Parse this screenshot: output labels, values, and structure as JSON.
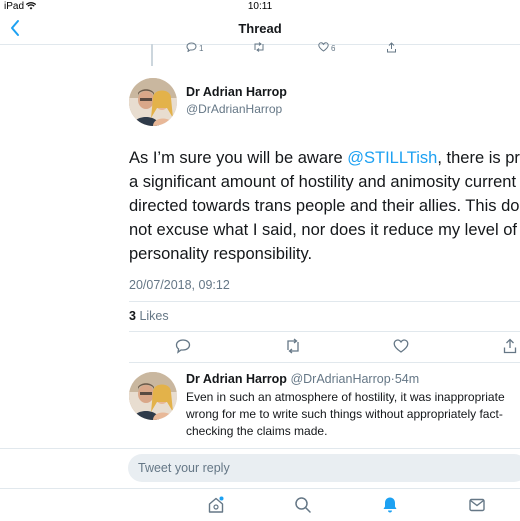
{
  "status_bar": {
    "device": "iPad",
    "time": "10:11"
  },
  "nav": {
    "title": "Thread"
  },
  "previous_tweet": {
    "actions": {
      "replies": "1",
      "retweets": "",
      "likes": "6"
    }
  },
  "tweet": {
    "author_name": "Dr Adrian Harrop",
    "author_handle": "@DrAdrianHarrop",
    "lines": [
      {
        "before": "As I’m sure you will be aware ",
        "mention": "@STILLTish",
        "after": ", there is pre"
      },
      {
        "text": "a significant amount of hostility and animosity current"
      },
      {
        "text": "directed towards trans people and their allies. This do"
      },
      {
        "text": "not excuse what I said, nor does it reduce my level of"
      },
      {
        "text": "personality responsibility."
      }
    ],
    "timestamp": "20/07/2018, 09:12",
    "likes_count": "3",
    "likes_label": "Likes"
  },
  "reply": {
    "author_name": "Dr Adrian Harrop",
    "author_handle": "@DrAdrianHarrop",
    "separator": "·",
    "time_ago": "54m",
    "lines": [
      "Even in such an atmosphere of hostility, it was inappropriate",
      "wrong for me to write such things without appropriately fact-",
      "checking the claims made."
    ]
  },
  "compose": {
    "placeholder": "Tweet your reply"
  },
  "colors": {
    "accent": "#1da1f2",
    "secondary_text": "#657786",
    "divider": "#e1e8ed",
    "compose_bg": "#e9eef2"
  },
  "icons": {
    "back": "chevron-left-icon",
    "reply": "reply-icon",
    "retweet": "retweet-icon",
    "like": "heart-icon",
    "share": "share-icon",
    "home": "home-icon",
    "search": "search-icon",
    "notifications": "bell-icon",
    "messages": "envelope-icon"
  }
}
